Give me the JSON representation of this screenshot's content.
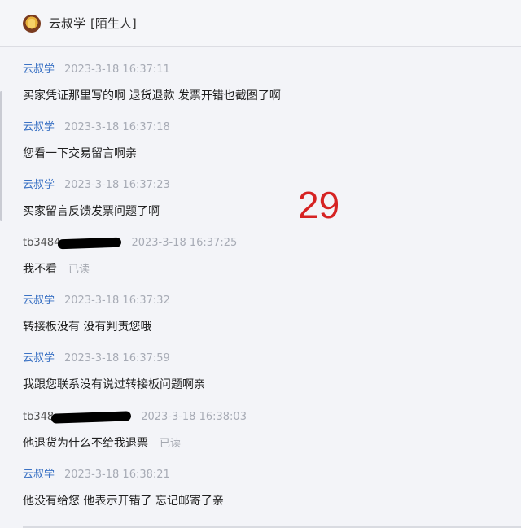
{
  "header": {
    "title": "云叔学",
    "tag": "[陌生人]"
  },
  "page_number": "29",
  "messages": [
    {
      "sender": "云叔学",
      "time": "2023-3-18 16:37:11",
      "text": "买家凭证那里写的啊  退货退款  发票开错也截图了啊",
      "read": ""
    },
    {
      "sender": "云叔学",
      "time": "2023-3-18 16:37:18",
      "text": "您看一下交易留言啊亲",
      "read": ""
    },
    {
      "sender": "云叔学",
      "time": "2023-3-18 16:37:23",
      "text": "买家留言反馈发票问题了啊",
      "read": ""
    },
    {
      "sender": "tb3484",
      "time": "2023-3-18 16:37:25",
      "text": "我不看",
      "read": "已读"
    },
    {
      "sender": "云叔学",
      "time": "2023-3-18 16:37:32",
      "text": "转接板没有 没有判责您哦",
      "read": ""
    },
    {
      "sender": "云叔学",
      "time": "2023-3-18 16:37:59",
      "text": "我跟您联系没有说过转接板问题啊亲",
      "read": ""
    },
    {
      "sender": "tb348",
      "time": "2023-3-18 16:38:03",
      "text": "他退货为什么不给我退票",
      "read": "已读"
    },
    {
      "sender": "云叔学",
      "time": "2023-3-18 16:38:21",
      "text": "他没有给您 他表示开错了 忘记邮寄了亲",
      "read": ""
    }
  ],
  "colors": {
    "background": "#f3f4f8",
    "sender_self": "#3b72c4",
    "timestamp": "#a7abb5",
    "page_number": "#d62323"
  },
  "icons": [
    "avatar-icon"
  ]
}
